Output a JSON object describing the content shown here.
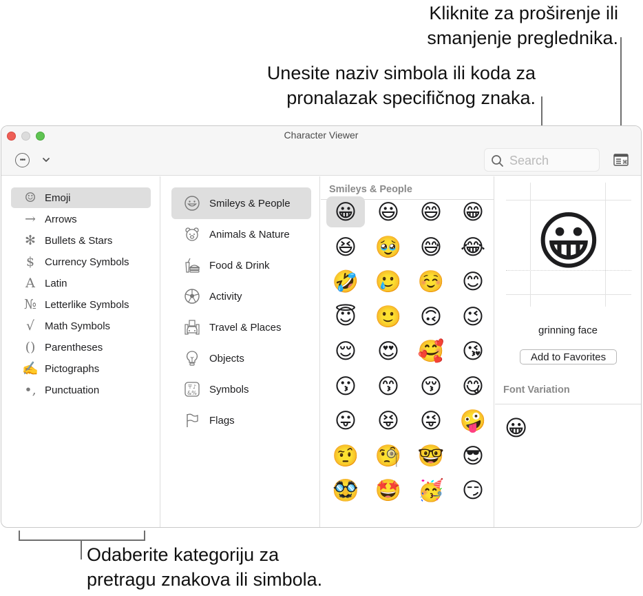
{
  "callouts": {
    "expand": [
      "Kliknite za proširenje ili",
      "smanjenje preglednika."
    ],
    "search": [
      "Unesite naziv simbola ili koda za",
      "pronalazak specifičnog znaka."
    ],
    "category": [
      "Odaberite kategoriju za",
      "pretragu znakova ili simbola."
    ]
  },
  "window": {
    "title": "Character Viewer",
    "more_icon": "ellipsis-circle-icon",
    "chevron_icon": "chevron-down-icon",
    "toggle_icon": "viewer-toggle-icon"
  },
  "search": {
    "placeholder": "Search",
    "value": ""
  },
  "categories": [
    {
      "icon": "☺",
      "label": "Emoji",
      "selected": true
    },
    {
      "icon": "→",
      "label": "Arrows"
    },
    {
      "icon": "✻",
      "label": "Bullets & Stars"
    },
    {
      "icon": "$",
      "label": "Currency Symbols"
    },
    {
      "icon": "A",
      "label": "Latin"
    },
    {
      "icon": "№",
      "label": "Letterlike Symbols"
    },
    {
      "icon": "√",
      "label": "Math Symbols"
    },
    {
      "icon": "()",
      "label": "Parentheses"
    },
    {
      "icon": "✍",
      "label": "Pictographs"
    },
    {
      "icon": "•,",
      "label": "Punctuation"
    }
  ],
  "subcategories": [
    {
      "icon": "smiley-icon",
      "label": "Smileys & People",
      "selected": true
    },
    {
      "icon": "bear-icon",
      "label": "Animals & Nature"
    },
    {
      "icon": "food-icon",
      "label": "Food & Drink"
    },
    {
      "icon": "soccer-ball-icon",
      "label": "Activity"
    },
    {
      "icon": "car-building-icon",
      "label": "Travel & Places"
    },
    {
      "icon": "lightbulb-icon",
      "label": "Objects"
    },
    {
      "icon": "symbols-icon",
      "label": "Symbols"
    },
    {
      "icon": "flag-icon",
      "label": "Flags"
    }
  ],
  "emoji_section": {
    "title": "Smileys & People",
    "emojis": [
      "😀",
      "😃",
      "😄",
      "😁",
      "😆",
      "🥹",
      "😅",
      "😂",
      "🤣",
      "🥲",
      "☺️",
      "😊",
      "😇",
      "🙂",
      "🙃",
      "😉",
      "😌",
      "😍",
      "🥰",
      "😘",
      "😗",
      "😙",
      "😚",
      "😋",
      "😛",
      "😝",
      "😜",
      "🤪",
      "🤨",
      "🧐",
      "🤓",
      "😎",
      "🥸",
      "🤩",
      "🥳",
      "😏"
    ],
    "selected_index": 0
  },
  "detail": {
    "emoji": "😀",
    "name": "grinning face",
    "favorites_button": "Add to Favorites",
    "font_variation_title": "Font Variation",
    "variations": [
      "😀"
    ]
  }
}
